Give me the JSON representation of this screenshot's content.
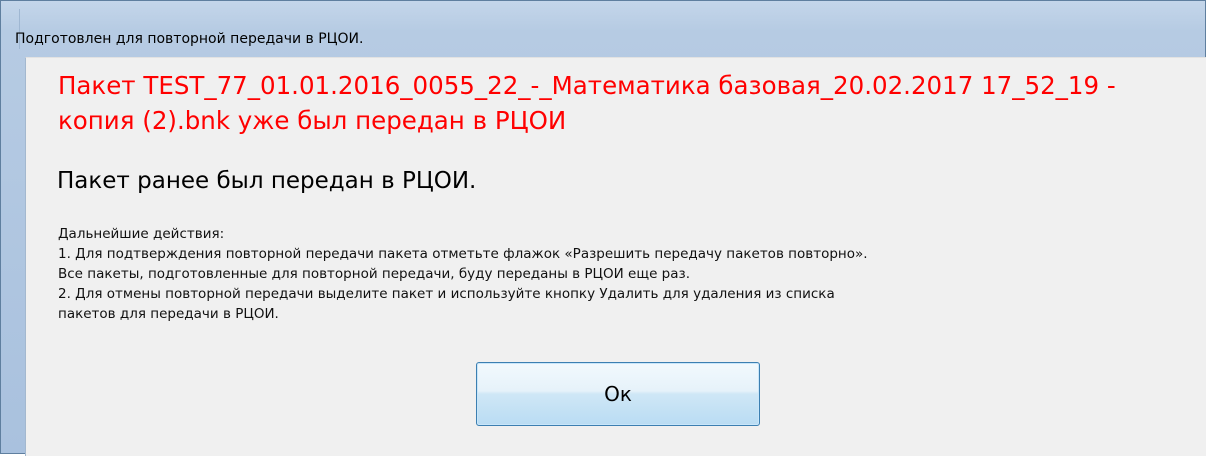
{
  "window": {
    "title": "Подготовлен для повторной передачи в РЦОИ."
  },
  "message": {
    "header_red": "Пакет TEST_77_01.01.2016_0055_22_-_Математика базовая_20.02.2017 17_52_19 - копия (2).bnk уже был передан в РЦОИ",
    "header_black": "Пакет ранее был передан в РЦОИ.",
    "description_lines": [
      "Дальнейшие действия:",
      "1. Для подтверждения повторной передачи пакета отметьте флажок «Разрешить передачу пакетов повторно».",
      "Все пакеты, подготовленные для повторной передачи, буду переданы в РЦОИ еще раз.",
      "2. Для отмены повторной передачи выделите пакет и используйте кнопку Удалить для удаления из списка",
      "пакетов для передачи в РЦОИ."
    ]
  },
  "buttons": {
    "ok_label": "Ок"
  },
  "colors": {
    "alert_text": "#ff0000",
    "client_background": "#f0f0f0",
    "button_border": "#3c7fb1"
  }
}
